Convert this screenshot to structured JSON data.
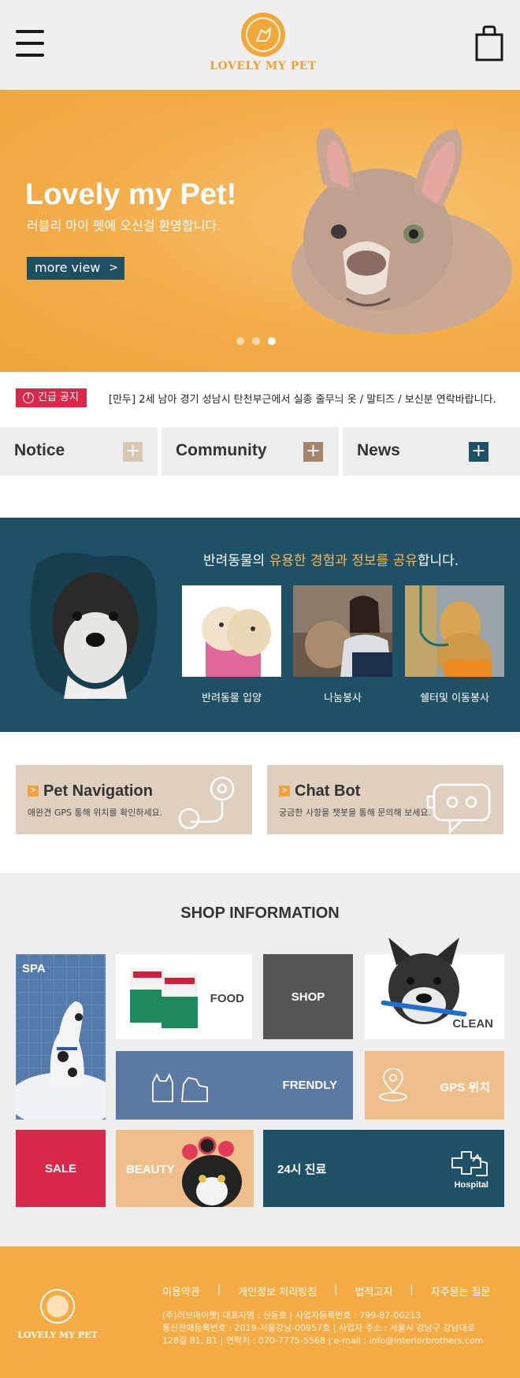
{
  "header": {
    "brand": "LOVELY MY PET",
    "menu_icon": "hamburger-menu-icon",
    "cart_icon": "shopping-bag-icon"
  },
  "hero": {
    "title": "Lovely my Pet!",
    "subtitle": "러블리 마이 펫에 오신걸 환영합니다.",
    "button_label": "more view",
    "button_icon": "chevron-right-icon",
    "slides": 3,
    "active_slide": 3
  },
  "notice": {
    "badge": "긴급 공지",
    "text": "[만두] 2세 남아 경기 성남시 탄천부근에서 실종 줄무늬 옷 / 말티즈 / 보신분 연락바랍니다."
  },
  "tabs": [
    {
      "label": "Notice",
      "icon": "plus-icon",
      "color": "#d8c7b5"
    },
    {
      "label": "Community",
      "icon": "plus-icon",
      "color": "#a6846c"
    },
    {
      "label": "News",
      "icon": "plus-icon",
      "color": "#1f5166"
    }
  ],
  "share": {
    "title_pre": "반려동물의 ",
    "title_highlight": "유용한 경험과 정보를 공유",
    "title_post": "합니다.",
    "cards": [
      {
        "label": "반려동물 입양"
      },
      {
        "label": "나눔봉사"
      },
      {
        "label": "쉘터및 이동봉사"
      }
    ]
  },
  "nav_boxes": [
    {
      "title": "Pet Navigation",
      "subtitle": "애완견 GPS 통해 위치를 확인하세요.",
      "icon": "map-pin-icon"
    },
    {
      "title": "Chat Bot",
      "subtitle": "궁금한 사항을 챗봇을 통해 문의해 보세요.",
      "icon": "robot-icon"
    }
  ],
  "shop": {
    "title": "SHOP INFORMATION",
    "tiles": {
      "spa": "SPA",
      "food": "FOOD",
      "shop": "SHOP",
      "clean": "CLEAN",
      "friendly": "FRENDLY",
      "gps": "GPS 위치",
      "sale": "SALE",
      "beauty": "BEAUTY",
      "clinic": "24시 진료",
      "hospital": "Hospital"
    },
    "colors": {
      "blue_tile": "#5a79a3",
      "peach_tile": "#efbf8b",
      "dark_tile": "#555555",
      "sale_tile": "#d9294a",
      "navy_tile": "#1f5166"
    }
  },
  "footer": {
    "brand": "LOVELY MY PET",
    "links": [
      "이용약관",
      "개인정보 처리방침",
      "법적고지",
      "자주묻는 질문"
    ],
    "separator": "|",
    "info_lines": [
      "(주)러브마이펫| 대표자명 : 신동호 | 사업자등록번호 : 799-87-00213",
      "통신판매등록번호 : 2019-서울강남-00957호 | 사업자 주소 : 서울시 강남구 강남대로",
      "128길 81, B1 | 연락처 : 070-7775-5568 | e-mail : info@interiorbrothers.com"
    ]
  },
  "colors": {
    "brand_orange": "#f2a73b",
    "navy": "#1f5166",
    "alert_red": "#d9294a"
  }
}
